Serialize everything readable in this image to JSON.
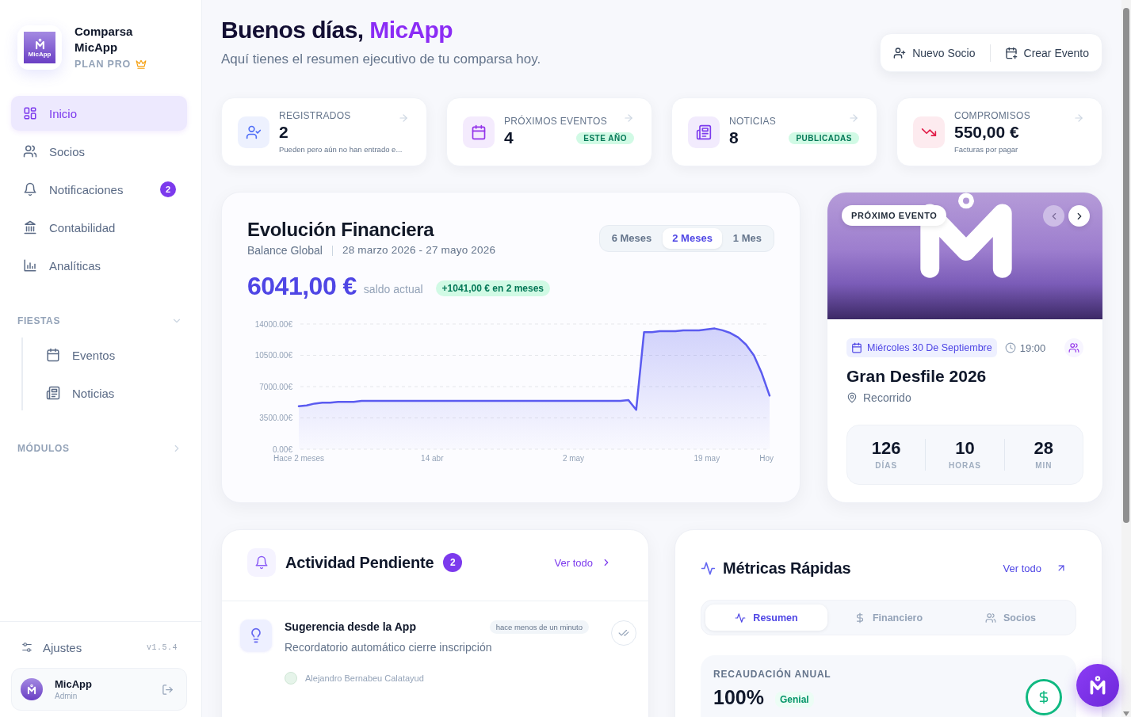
{
  "sidebar": {
    "brand": {
      "logo_text": "MicApp",
      "name": "Comparsa MicApp",
      "plan": "PLAN PRO"
    },
    "nav": [
      {
        "label": "Inicio",
        "selected": true
      },
      {
        "label": "Socios",
        "selected": false
      },
      {
        "label": "Notificaciones",
        "selected": false,
        "badge": "2"
      },
      {
        "label": "Contabilidad",
        "selected": false
      },
      {
        "label": "Analíticas",
        "selected": false
      }
    ],
    "sections": [
      {
        "title": "FIESTAS",
        "expanded": true,
        "items": [
          {
            "label": "Eventos",
            "selected": false
          },
          {
            "label": "Noticias",
            "selected": false
          }
        ]
      },
      {
        "title": "MÓDULOS",
        "expanded": false
      }
    ],
    "settings": {
      "label": "Ajustes",
      "version": "v1.5.4"
    },
    "user": {
      "name": "MicApp",
      "role": "Admin"
    }
  },
  "header": {
    "greeting": "Buenos días,",
    "name": "MicApp",
    "subtitle": "Aquí tienes el resumen ejecutivo de tu comparsa hoy.",
    "actions": [
      "Nuevo Socio",
      "Crear Evento"
    ]
  },
  "stats": [
    {
      "label": "REGISTRADOS",
      "value": "2",
      "note": "Pueden pero aún no han entrado e..."
    },
    {
      "label": "PRÓXIMOS EVENTOS",
      "value": "4",
      "badge": "ESTE AÑO"
    },
    {
      "label": "NOTICIAS",
      "value": "8",
      "badge": "PUBLICADAS"
    },
    {
      "label": "COMPROMISOS",
      "value": "550,00 €",
      "note": "Facturas por pagar"
    }
  ],
  "finance": {
    "title": "Evolución Financiera",
    "subtitle": "Balance Global",
    "range": "28 marzo 2026 - 27 mayo 2026",
    "periods": [
      {
        "label": "6 Meses",
        "selected": false
      },
      {
        "label": "2 Meses",
        "selected": true
      },
      {
        "label": "1 Mes",
        "selected": false
      }
    ],
    "balance": "6041,00 €",
    "balance_label": "saldo actual",
    "change": "+1041,00 € en 2 meses",
    "chart_data": {
      "type": "area",
      "grid": true,
      "categories": [
        "Hace 2 meses",
        null,
        null,
        null,
        null,
        null,
        null,
        null,
        null,
        null,
        null,
        null,
        null,
        null,
        null,
        null,
        null,
        "14 abr",
        null,
        null,
        null,
        null,
        null,
        null,
        null,
        null,
        null,
        null,
        null,
        null,
        null,
        null,
        null,
        null,
        null,
        "2 may",
        null,
        null,
        null,
        null,
        null,
        null,
        null,
        null,
        null,
        null,
        null,
        null,
        null,
        null,
        null,
        null,
        "19 may",
        null,
        null,
        null,
        null,
        null,
        null,
        null,
        "Hoy"
      ],
      "values": [
        4800,
        4900,
        5100,
        5200,
        5200,
        5300,
        5300,
        5300,
        5400,
        5400,
        5400,
        5400,
        5400,
        5400,
        5400,
        5400,
        5400,
        5400,
        5400,
        5400,
        5400,
        5400,
        5400,
        5400,
        5400,
        5400,
        5400,
        5400,
        5400,
        5400,
        5400,
        5400,
        5400,
        5400,
        5400,
        5400,
        5400,
        5400,
        5400,
        5400,
        5400,
        5400,
        5500,
        4400,
        13100,
        13100,
        13200,
        13200,
        13200,
        13300,
        13300,
        13300,
        13400,
        13500,
        13300,
        13000,
        12500,
        11700,
        10500,
        8500,
        6000
      ],
      "ylim": [
        0,
        14000
      ],
      "yticks": [
        {
          "value": 0,
          "label": "0.00€"
        },
        {
          "value": 3500,
          "label": "3500.00€"
        },
        {
          "value": 7000,
          "label": "7000.00€"
        },
        {
          "value": 10500,
          "label": "10500.00€"
        },
        {
          "value": 14000,
          "label": "14000.00€"
        }
      ]
    }
  },
  "event": {
    "tag": "PRÓXIMO EVENTO",
    "prev_disabled": true,
    "next_disabled": false,
    "date": "Miércoles 30 De Septiembre",
    "time": "19:00",
    "title": "Gran Desfile 2026",
    "location": "Recorrido",
    "countdown": [
      {
        "value": "126",
        "unit": "DÍAS"
      },
      {
        "value": "10",
        "unit": "HORAS"
      },
      {
        "value": "28",
        "unit": "MIN"
      }
    ]
  },
  "activity": {
    "title": "Actividad Pendiente",
    "count": "2",
    "link": "Ver todo",
    "items": [
      {
        "title": "Sugerencia desde la App",
        "time": "hace menos de un minuto",
        "text": "Recordatorio automático cierre inscripción",
        "author": "Alejandro Bernabeu Calatayud"
      }
    ]
  },
  "metrics": {
    "title": "Métricas Rápidas",
    "link": "Ver todo",
    "tabs": [
      {
        "label": "Resumen",
        "selected": true
      },
      {
        "label": "Financiero",
        "selected": false
      },
      {
        "label": "Socios",
        "selected": false
      }
    ],
    "panels": [
      {
        "label": "RECAUDACIÓN ANUAL",
        "value": "100%",
        "badge": "Genial"
      }
    ]
  }
}
